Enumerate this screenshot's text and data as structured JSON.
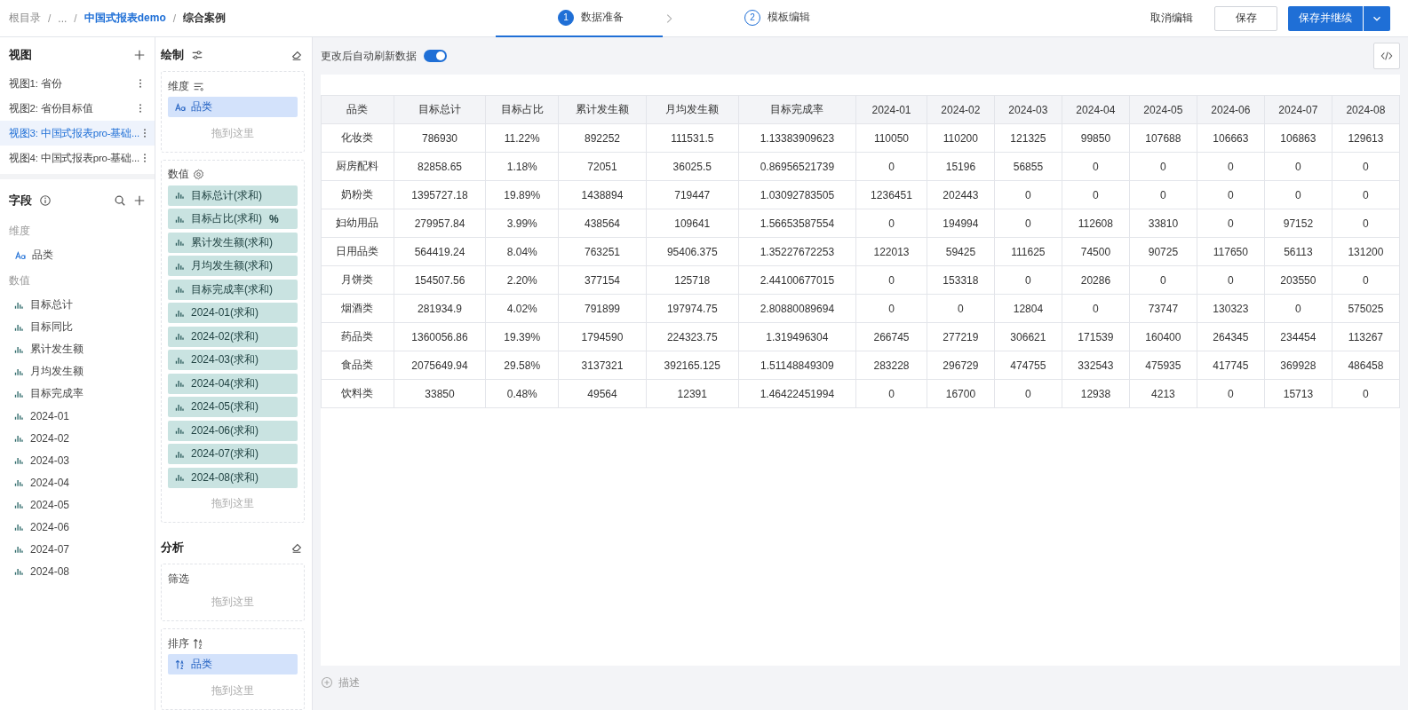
{
  "breadcrumb_separator": "/",
  "breadcrumb": [
    {
      "label": "根目录",
      "kind": "muted"
    },
    {
      "label": "...",
      "kind": "muted"
    },
    {
      "label": "中国式报表demo",
      "kind": "link"
    },
    {
      "label": "综合案例",
      "kind": "current"
    }
  ],
  "steps": [
    {
      "number": "1",
      "label": "数据准备",
      "selected": true
    },
    {
      "number": "2",
      "label": "模板编辑",
      "selected": false
    }
  ],
  "actions": {
    "cancel": "取消编辑",
    "save": "保存",
    "save_continue": "保存并继续"
  },
  "views": {
    "title": "视图",
    "items": [
      {
        "label": "视图1: 省份",
        "selected": false
      },
      {
        "label": "视图2: 省份目标值",
        "selected": false
      },
      {
        "label": "视图3: 中国式报表pro-基础...",
        "selected": true
      },
      {
        "label": "视图4: 中国式报表pro-基础...",
        "selected": false
      }
    ]
  },
  "fields": {
    "title": "字段",
    "groups": [
      {
        "title": "维度",
        "items": [
          {
            "label": "品类",
            "kind": "text"
          }
        ]
      },
      {
        "title": "数值",
        "items": [
          {
            "label": "目标总计",
            "kind": "number"
          },
          {
            "label": "目标同比",
            "kind": "number"
          },
          {
            "label": "累计发生额",
            "kind": "number"
          },
          {
            "label": "月均发生额",
            "kind": "number"
          },
          {
            "label": "目标完成率",
            "kind": "number"
          },
          {
            "label": "2024-01",
            "kind": "number"
          },
          {
            "label": "2024-02",
            "kind": "number"
          },
          {
            "label": "2024-03",
            "kind": "number"
          },
          {
            "label": "2024-04",
            "kind": "number"
          },
          {
            "label": "2024-05",
            "kind": "number"
          },
          {
            "label": "2024-06",
            "kind": "number"
          },
          {
            "label": "2024-07",
            "kind": "number"
          },
          {
            "label": "2024-08",
            "kind": "number"
          }
        ]
      }
    ]
  },
  "draw": {
    "title": "绘制",
    "zones": [
      {
        "title": "维度",
        "kind": "dimension",
        "chips": [
          {
            "label": "品类",
            "kind": "text"
          }
        ],
        "drop_hint": "拖到这里"
      },
      {
        "title": "数值",
        "kind": "measure",
        "chips": [
          {
            "label": "目标总计(求和)",
            "kind": "number"
          },
          {
            "label": "目标占比(求和)",
            "kind": "number",
            "suffix": "%"
          },
          {
            "label": "累计发生额(求和)",
            "kind": "number"
          },
          {
            "label": "月均发生额(求和)",
            "kind": "number"
          },
          {
            "label": "目标完成率(求和)",
            "kind": "number"
          },
          {
            "label": "2024-01(求和)",
            "kind": "number"
          },
          {
            "label": "2024-02(求和)",
            "kind": "number"
          },
          {
            "label": "2024-03(求和)",
            "kind": "number"
          },
          {
            "label": "2024-04(求和)",
            "kind": "number"
          },
          {
            "label": "2024-05(求和)",
            "kind": "number"
          },
          {
            "label": "2024-06(求和)",
            "kind": "number"
          },
          {
            "label": "2024-07(求和)",
            "kind": "number"
          },
          {
            "label": "2024-08(求和)",
            "kind": "number"
          }
        ],
        "drop_hint": "拖到这里"
      }
    ]
  },
  "analysis": {
    "title": "分析",
    "zones": [
      {
        "title": "筛选",
        "kind": "filter",
        "drop_hint": "拖到这里"
      },
      {
        "title": "排序",
        "kind": "sort",
        "chips": [
          {
            "label": "品类",
            "kind": "sort"
          }
        ],
        "drop_hint": "拖到这里"
      }
    ]
  },
  "auto_refresh": {
    "label": "更改后自动刷新数据",
    "on": true
  },
  "table": {
    "columns": [
      "品类",
      "目标总计",
      "目标占比",
      "累计发生额",
      "月均发生额",
      "目标完成率",
      "2024-01",
      "2024-02",
      "2024-03",
      "2024-04",
      "2024-05",
      "2024-06",
      "2024-07",
      "2024-08"
    ],
    "rows": [
      [
        "化妆类",
        "786930",
        "11.22%",
        "892252",
        "111531.5",
        "1.13383909623",
        "110050",
        "110200",
        "121325",
        "99850",
        "107688",
        "106663",
        "106863",
        "129613"
      ],
      [
        "厨房配料",
        "82858.65",
        "1.18%",
        "72051",
        "36025.5",
        "0.86956521739",
        "0",
        "15196",
        "56855",
        "0",
        "0",
        "0",
        "0",
        "0"
      ],
      [
        "奶粉类",
        "1395727.18",
        "19.89%",
        "1438894",
        "719447",
        "1.03092783505",
        "1236451",
        "202443",
        "0",
        "0",
        "0",
        "0",
        "0",
        "0"
      ],
      [
        "妇幼用品",
        "279957.84",
        "3.99%",
        "438564",
        "109641",
        "1.56653587554",
        "0",
        "194994",
        "0",
        "112608",
        "33810",
        "0",
        "97152",
        "0"
      ],
      [
        "日用品类",
        "564419.24",
        "8.04%",
        "763251",
        "95406.375",
        "1.35227672253",
        "122013",
        "59425",
        "111625",
        "74500",
        "90725",
        "117650",
        "56113",
        "131200"
      ],
      [
        "月饼类",
        "154507.56",
        "2.20%",
        "377154",
        "125718",
        "2.44100677015",
        "0",
        "153318",
        "0",
        "20286",
        "0",
        "0",
        "203550",
        "0"
      ],
      [
        "烟酒类",
        "281934.9",
        "4.02%",
        "791899",
        "197974.75",
        "2.80880089694",
        "0",
        "0",
        "12804",
        "0",
        "73747",
        "130323",
        "0",
        "575025"
      ],
      [
        "药品类",
        "1360056.86",
        "19.39%",
        "1794590",
        "224323.75",
        "1.319496304",
        "266745",
        "277219",
        "306621",
        "171539",
        "160400",
        "264345",
        "234454",
        "113267"
      ],
      [
        "食品类",
        "2075649.94",
        "29.58%",
        "3137321",
        "392165.125",
        "1.51148849309",
        "283228",
        "296729",
        "474755",
        "332543",
        "475935",
        "417745",
        "369928",
        "486458"
      ],
      [
        "饮料类",
        "33850",
        "0.48%",
        "49564",
        "12391",
        "1.46422451994",
        "0",
        "16700",
        "0",
        "12938",
        "4213",
        "0",
        "15713",
        "0"
      ]
    ]
  },
  "describe": "描述"
}
